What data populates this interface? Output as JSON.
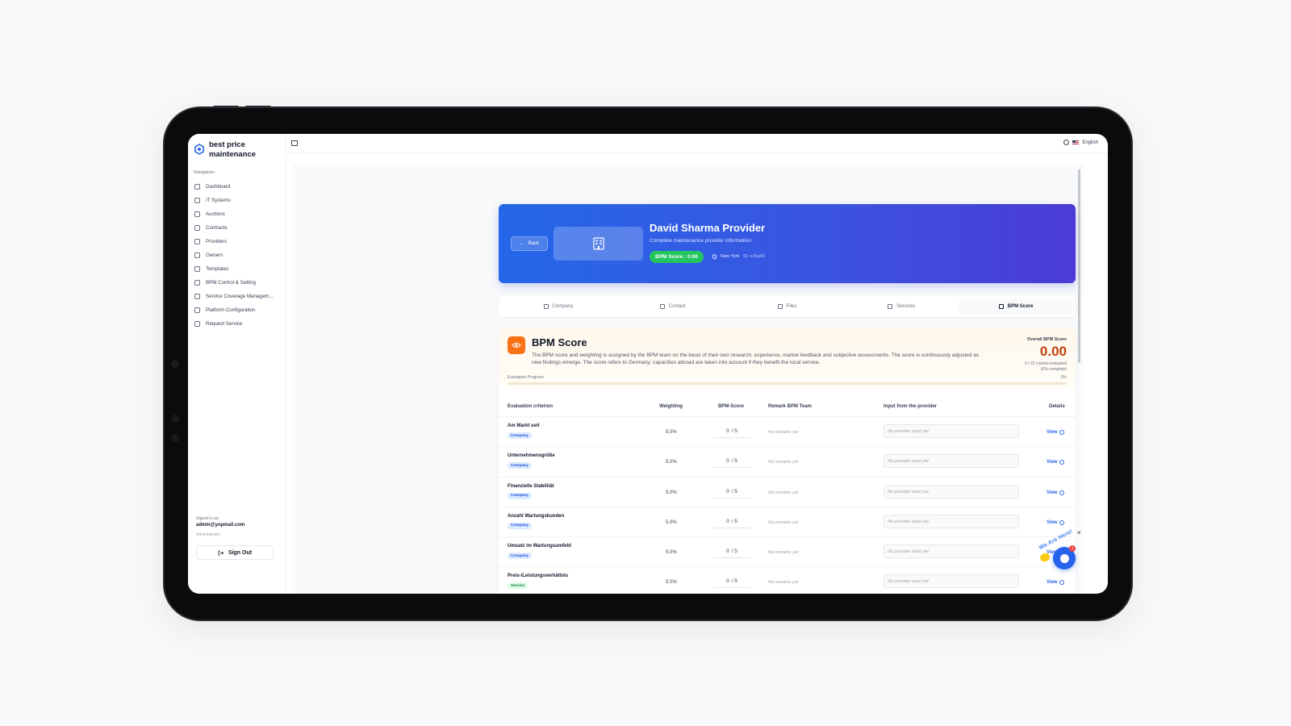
{
  "brand": {
    "name": "best price maintenance"
  },
  "nav": {
    "heading": "Navigation",
    "items": [
      {
        "label": "Dashboard",
        "icon": "home-icon"
      },
      {
        "label": "IT Systems",
        "icon": "server-icon"
      },
      {
        "label": "Auctions",
        "icon": "clock-icon"
      },
      {
        "label": "Contracts",
        "icon": "file-icon"
      },
      {
        "label": "Providers",
        "icon": "users-icon"
      },
      {
        "label": "Owners",
        "icon": "user-icon"
      },
      {
        "label": "Templates",
        "icon": "template-icon"
      },
      {
        "label": "BPM Control & Setting",
        "icon": "gear-icon"
      },
      {
        "label": "Service Coverage Managem...",
        "icon": "globe-icon"
      },
      {
        "label": "Platform Configuration",
        "icon": "settings-icon"
      },
      {
        "label": "Request Service",
        "icon": "request-icon"
      }
    ]
  },
  "user": {
    "signed_label": "Signed in as:",
    "email": "admin@yopmail.com",
    "role": "Administrator",
    "signout_label": "Sign Out"
  },
  "topbar": {
    "language": "English"
  },
  "hero": {
    "back_label": "Back",
    "title": "David Sharma Provider",
    "subtitle": "Complete maintenance provider information",
    "badge": "BPM Score : 0.00",
    "location": "New York",
    "id_text": "ID: e35a65"
  },
  "tabs": [
    {
      "label": "Company",
      "icon": "building-icon"
    },
    {
      "label": "Contact",
      "icon": "user-icon"
    },
    {
      "label": "Files",
      "icon": "file-icon"
    },
    {
      "label": "Services",
      "icon": "clipboard-icon"
    },
    {
      "label": "BPM Score",
      "icon": "file-icon"
    }
  ],
  "bpm": {
    "title": "BPM Score",
    "description": "The BPM score and weighting is assigned by the BPM team on the basis of their own research, experience, market feedback and subjective assessments. The score is continuously adjusted as new findings emerge. The score refers to Germany; capacities abroad are taken into account if they benefit the local service.",
    "overall_label": "Overall BPM Score",
    "overall_value": "0.00",
    "criteria_evaluated": "0 / 22 criteria evaluated",
    "complete_text": "(0% complete)",
    "progress_label": "Evaluation Progress",
    "progress_pct_text": "0%",
    "progress_fraction": 0,
    "accent_color": "#f97316"
  },
  "table": {
    "headers": {
      "criterion": "Evaluation criterion",
      "weighting": "Weighting",
      "score": "BPM-Score",
      "remark": "Remark BPM Team",
      "input": "Input from the provider",
      "details": "Details"
    },
    "rows": [
      {
        "name": "Am Markt seit",
        "tag": "Company",
        "weight": "5.0%",
        "score": "0",
        "max": "/ 5",
        "remark": "No remarks yet",
        "input": "No provider input yet",
        "view": "View"
      },
      {
        "name": "Unternehmensgröße",
        "tag": "Company",
        "weight": "5.0%",
        "score": "0",
        "max": "/ 5",
        "remark": "No remarks yet",
        "input": "No provider input yet",
        "view": "View"
      },
      {
        "name": "Finanzielle Stabilität",
        "tag": "Company",
        "weight": "5.0%",
        "score": "0",
        "max": "/ 5",
        "remark": "No remarks yet",
        "input": "No provider input yet",
        "view": "View"
      },
      {
        "name": "Anzahl Wartungskunden",
        "tag": "Company",
        "weight": "5.0%",
        "score": "0",
        "max": "/ 5",
        "remark": "No remarks yet",
        "input": "No provider input yet",
        "view": "View"
      },
      {
        "name": "Umsatz im Wartungsumfeld",
        "tag": "Company",
        "weight": "5.0%",
        "score": "0",
        "max": "/ 5",
        "remark": "No remarks yet",
        "input": "No provider input yet",
        "view": "View"
      },
      {
        "name": "Preis-/Leistungsverhältnis",
        "tag": "Service",
        "weight": "5.0%",
        "score": "0",
        "max": "/ 5",
        "remark": "No remarks yet",
        "input": "No provider input yet",
        "view": "View"
      }
    ]
  },
  "help_widget": {
    "text": "We Are Here!",
    "badge_count": "1",
    "close": "×"
  }
}
